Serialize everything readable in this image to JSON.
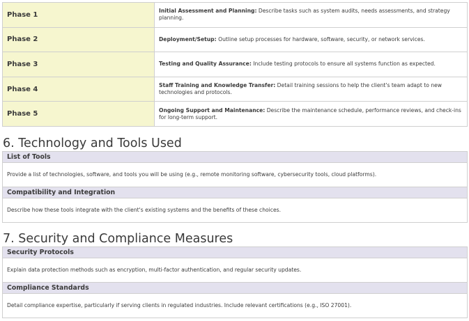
{
  "phases": [
    {
      "name": "Phase 1",
      "lead": "Initial Assessment and Planning:",
      "text": " Describe tasks such as system audits, needs assessments, and strategy planning."
    },
    {
      "name": "Phase 2",
      "lead": "Deployment/Setup:",
      "text": " Outline setup processes for hardware, software, security, or network services."
    },
    {
      "name": "Phase 3",
      "lead": "Testing and Quality Assurance:",
      "text": " Include testing protocols to ensure all systems function as expected."
    },
    {
      "name": "Phase 4",
      "lead": "Staff Training and Knowledge Transfer:",
      "text": " Detail training sessions to help the client's team adapt to new technologies and protocols."
    },
    {
      "name": "Phase 5",
      "lead": "Ongoing Support and Maintenance:",
      "text": " Describe the maintenance schedule, performance reviews, and check-ins for long-term support."
    }
  ],
  "section6": {
    "title": "6. Technology and Tools Used",
    "items": [
      {
        "heading": "List of Tools",
        "body": "Provide a list of technologies, software, and tools you will be using (e.g., remote monitoring software, cybersecurity tools, cloud platforms)."
      },
      {
        "heading": "Compatibility and Integration",
        "body": "Describe how these tools integrate with the client's existing systems and the benefits of these choices."
      }
    ]
  },
  "section7": {
    "title": "7. Security and Compliance Measures",
    "items": [
      {
        "heading": "Security Protocols",
        "body": "Explain data protection methods such as encryption, multi-factor authentication, and regular security updates."
      },
      {
        "heading": "Compliance Standards",
        "body": "Detail compliance expertise, particularly if serving clients in regulated industries. Include relevant certifications (e.g., ISO 27001)."
      }
    ]
  },
  "colors": {
    "phase_cell_bg": "#f6f6cf",
    "subheading_bg": "#e3e1ee",
    "border": "#cfcfcf",
    "text": "#3a3a3a"
  }
}
